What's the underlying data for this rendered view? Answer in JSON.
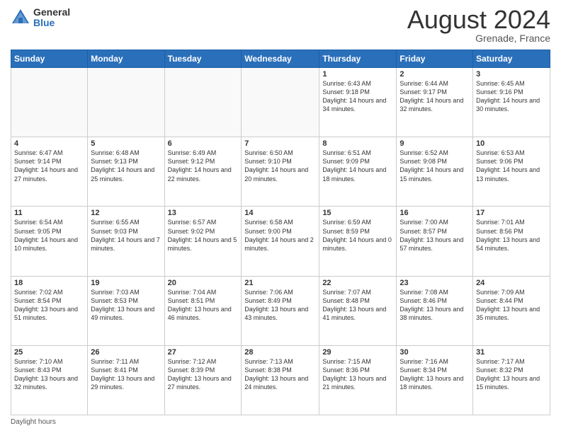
{
  "header": {
    "logo_general": "General",
    "logo_blue": "Blue",
    "month_title": "August 2024",
    "location": "Grenade, France"
  },
  "weekdays": [
    "Sunday",
    "Monday",
    "Tuesday",
    "Wednesday",
    "Thursday",
    "Friday",
    "Saturday"
  ],
  "footer": {
    "label": "Daylight hours"
  },
  "weeks": [
    [
      {
        "day": "",
        "info": ""
      },
      {
        "day": "",
        "info": ""
      },
      {
        "day": "",
        "info": ""
      },
      {
        "day": "",
        "info": ""
      },
      {
        "day": "1",
        "info": "Sunrise: 6:43 AM\nSunset: 9:18 PM\nDaylight: 14 hours\nand 34 minutes."
      },
      {
        "day": "2",
        "info": "Sunrise: 6:44 AM\nSunset: 9:17 PM\nDaylight: 14 hours\nand 32 minutes."
      },
      {
        "day": "3",
        "info": "Sunrise: 6:45 AM\nSunset: 9:16 PM\nDaylight: 14 hours\nand 30 minutes."
      }
    ],
    [
      {
        "day": "4",
        "info": "Sunrise: 6:47 AM\nSunset: 9:14 PM\nDaylight: 14 hours\nand 27 minutes."
      },
      {
        "day": "5",
        "info": "Sunrise: 6:48 AM\nSunset: 9:13 PM\nDaylight: 14 hours\nand 25 minutes."
      },
      {
        "day": "6",
        "info": "Sunrise: 6:49 AM\nSunset: 9:12 PM\nDaylight: 14 hours\nand 22 minutes."
      },
      {
        "day": "7",
        "info": "Sunrise: 6:50 AM\nSunset: 9:10 PM\nDaylight: 14 hours\nand 20 minutes."
      },
      {
        "day": "8",
        "info": "Sunrise: 6:51 AM\nSunset: 9:09 PM\nDaylight: 14 hours\nand 18 minutes."
      },
      {
        "day": "9",
        "info": "Sunrise: 6:52 AM\nSunset: 9:08 PM\nDaylight: 14 hours\nand 15 minutes."
      },
      {
        "day": "10",
        "info": "Sunrise: 6:53 AM\nSunset: 9:06 PM\nDaylight: 14 hours\nand 13 minutes."
      }
    ],
    [
      {
        "day": "11",
        "info": "Sunrise: 6:54 AM\nSunset: 9:05 PM\nDaylight: 14 hours\nand 10 minutes."
      },
      {
        "day": "12",
        "info": "Sunrise: 6:55 AM\nSunset: 9:03 PM\nDaylight: 14 hours\nand 7 minutes."
      },
      {
        "day": "13",
        "info": "Sunrise: 6:57 AM\nSunset: 9:02 PM\nDaylight: 14 hours\nand 5 minutes."
      },
      {
        "day": "14",
        "info": "Sunrise: 6:58 AM\nSunset: 9:00 PM\nDaylight: 14 hours\nand 2 minutes."
      },
      {
        "day": "15",
        "info": "Sunrise: 6:59 AM\nSunset: 8:59 PM\nDaylight: 14 hours\nand 0 minutes."
      },
      {
        "day": "16",
        "info": "Sunrise: 7:00 AM\nSunset: 8:57 PM\nDaylight: 13 hours\nand 57 minutes."
      },
      {
        "day": "17",
        "info": "Sunrise: 7:01 AM\nSunset: 8:56 PM\nDaylight: 13 hours\nand 54 minutes."
      }
    ],
    [
      {
        "day": "18",
        "info": "Sunrise: 7:02 AM\nSunset: 8:54 PM\nDaylight: 13 hours\nand 51 minutes."
      },
      {
        "day": "19",
        "info": "Sunrise: 7:03 AM\nSunset: 8:53 PM\nDaylight: 13 hours\nand 49 minutes."
      },
      {
        "day": "20",
        "info": "Sunrise: 7:04 AM\nSunset: 8:51 PM\nDaylight: 13 hours\nand 46 minutes."
      },
      {
        "day": "21",
        "info": "Sunrise: 7:06 AM\nSunset: 8:49 PM\nDaylight: 13 hours\nand 43 minutes."
      },
      {
        "day": "22",
        "info": "Sunrise: 7:07 AM\nSunset: 8:48 PM\nDaylight: 13 hours\nand 41 minutes."
      },
      {
        "day": "23",
        "info": "Sunrise: 7:08 AM\nSunset: 8:46 PM\nDaylight: 13 hours\nand 38 minutes."
      },
      {
        "day": "24",
        "info": "Sunrise: 7:09 AM\nSunset: 8:44 PM\nDaylight: 13 hours\nand 35 minutes."
      }
    ],
    [
      {
        "day": "25",
        "info": "Sunrise: 7:10 AM\nSunset: 8:43 PM\nDaylight: 13 hours\nand 32 minutes."
      },
      {
        "day": "26",
        "info": "Sunrise: 7:11 AM\nSunset: 8:41 PM\nDaylight: 13 hours\nand 29 minutes."
      },
      {
        "day": "27",
        "info": "Sunrise: 7:12 AM\nSunset: 8:39 PM\nDaylight: 13 hours\nand 27 minutes."
      },
      {
        "day": "28",
        "info": "Sunrise: 7:13 AM\nSunset: 8:38 PM\nDaylight: 13 hours\nand 24 minutes."
      },
      {
        "day": "29",
        "info": "Sunrise: 7:15 AM\nSunset: 8:36 PM\nDaylight: 13 hours\nand 21 minutes."
      },
      {
        "day": "30",
        "info": "Sunrise: 7:16 AM\nSunset: 8:34 PM\nDaylight: 13 hours\nand 18 minutes."
      },
      {
        "day": "31",
        "info": "Sunrise: 7:17 AM\nSunset: 8:32 PM\nDaylight: 13 hours\nand 15 minutes."
      }
    ]
  ]
}
